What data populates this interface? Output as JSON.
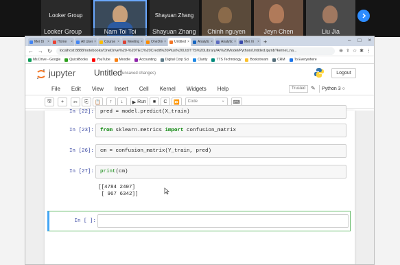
{
  "zoom": {
    "tiles": [
      {
        "name": "Looker Group",
        "sub": "Looker Group",
        "active": false
      },
      {
        "name": "",
        "sub": "Nam Toi Toi",
        "active": true
      },
      {
        "name": "Shayuan Zhang",
        "sub": "Shayuan Zhang",
        "active": false
      },
      {
        "name": "",
        "sub": "Chinh nguyen",
        "active": false
      },
      {
        "name": "",
        "sub": "Jeyn Chen",
        "active": false
      },
      {
        "name": "",
        "sub": "Liu Jia",
        "active": false
      }
    ]
  },
  "browser": {
    "tabs": [
      {
        "title": "Mei Di",
        "color": "#4285f4"
      },
      {
        "title": "Home",
        "color": "#ea4335"
      },
      {
        "title": "All User",
        "color": "#4285f4"
      },
      {
        "title": "Course",
        "color": "#fbbc05"
      },
      {
        "title": "Meeting",
        "color": "#db4437"
      },
      {
        "title": "OneDrive",
        "color": "#fb8c00"
      },
      {
        "title": "Untitled",
        "color": "#f37626",
        "active": true
      },
      {
        "title": "Analytics",
        "color": "#1565c0"
      },
      {
        "title": "Analytics",
        "color": "#5c6bc0"
      },
      {
        "title": "Mei Xi",
        "color": "#3949ab"
      }
    ],
    "new_tab": "+",
    "window_controls": [
      "–",
      "□",
      "×"
    ],
    "url": "localhost:8888/notebooks/OneDrive%20-%20TEC%20Credit%20Plus%20Ltd/TTS%20Library/AI%20Model/Python/Untitled.ipynb?kernel_na...",
    "bookmarks": [
      {
        "label": "Ms Drive - Google",
        "color": "#0f9d58"
      },
      {
        "label": "QuickBooks",
        "color": "#2ca01c"
      },
      {
        "label": "YouTube",
        "color": "#ff0000"
      },
      {
        "label": "Moodle",
        "color": "#f98012"
      },
      {
        "label": "Accounting",
        "color": "#8e24aa"
      },
      {
        "label": "Digital Corp Sci",
        "color": "#607d8b"
      },
      {
        "label": "Clarity",
        "color": "#1e88e5"
      },
      {
        "label": "TTS Technology",
        "color": "#00897b"
      },
      {
        "label": "Bookstream",
        "color": "#fbc02d"
      },
      {
        "label": "CRM",
        "color": "#546e7a"
      },
      {
        "label": "To Everywhere",
        "color": "#1a73e8"
      }
    ]
  },
  "jupyter": {
    "brand": "jupyter",
    "title": "Untitled",
    "unsaved": "(unsaved changes)",
    "logout": "Logout",
    "menu": [
      "File",
      "Edit",
      "View",
      "Insert",
      "Cell",
      "Kernel",
      "Widgets",
      "Help"
    ],
    "trusted": "Trusted",
    "kernel": "Python 3 ○",
    "toolbar": {
      "run_label": "Run",
      "cell_type": "Code"
    }
  },
  "cells": {
    "c22": {
      "prompt": "In [22]:",
      "code": "pred = model.predict(X_train)"
    },
    "c23": {
      "prompt": "In [23]:",
      "code": "from sklearn.metrics import confusion_matrix"
    },
    "c26": {
      "prompt": "In [26]:",
      "code": "cm = confusion_matrix(Y_train, pred)"
    },
    "c27": {
      "prompt": "In [27]:",
      "code": "print(cm)",
      "output": "[[4784 2407]\n [ 967 6342]]"
    },
    "empty": {
      "prompt": "In [ ]:"
    }
  }
}
